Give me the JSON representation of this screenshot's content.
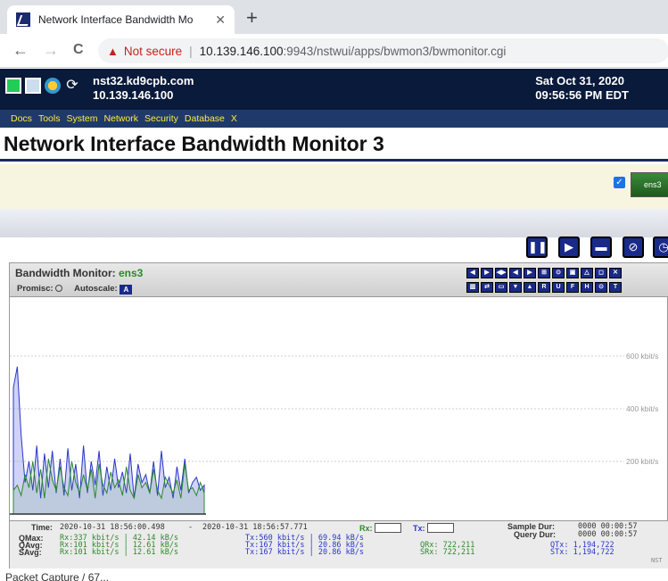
{
  "browser": {
    "tab_title": "Network Interface Bandwidth Mo",
    "tab_close": "✕",
    "new_tab": "+",
    "back": "←",
    "forward": "→",
    "reload": "C",
    "warning_icon": "▲",
    "not_secure": "Not secure",
    "url_host": "10.139.146.100",
    "url_rest": ":9943/nstwui/apps/bwmon3/bwmonitor.cgi"
  },
  "header": {
    "hostname": "nst32.kd9cpb.com",
    "ip": "10.139.146.100",
    "date": "Sat Oct 31, 2020",
    "time": "09:56:56 PM EDT"
  },
  "menu": [
    "Docs",
    "Tools",
    "System",
    "Network",
    "Security",
    "Database",
    "X"
  ],
  "page_title": "Network Interface Bandwidth Monitor 3",
  "interface_card_label": "ens3",
  "panel": {
    "title_prefix": "Bandwidth Monitor:",
    "interface": "ens3",
    "promisc_label": "Promisc:",
    "autoscale_label": "Autoscale:",
    "autoscale_btn": "A"
  },
  "toolbar_row1": [
    "◀",
    "▶",
    "◀▶",
    "◀",
    "▶",
    "⊞",
    "⊙",
    "▣",
    "△",
    "◻",
    "✕"
  ],
  "toolbar_row2": [
    "▥",
    "⇄",
    "▭",
    "▼",
    "▲",
    "R",
    "U",
    "F",
    "H",
    "⊙",
    "T"
  ],
  "chart_data": {
    "type": "area",
    "y_tick_labels": [
      "600 kbit/s",
      "400 kbit/s",
      "200 kbit/s"
    ],
    "y_ticks": [
      600,
      400,
      200
    ],
    "ylim": [
      0,
      800
    ],
    "grid": true,
    "series": [
      {
        "name": "Tx",
        "color": "#2a35c8",
        "values": [
          480,
          560,
          300,
          120,
          200,
          90,
          260,
          60,
          230,
          100,
          240,
          80,
          210,
          70,
          250,
          90,
          190,
          60,
          260,
          80,
          200,
          110,
          240,
          70,
          180,
          90,
          210,
          100,
          160,
          80,
          230,
          60,
          190,
          120,
          150,
          80,
          200,
          70,
          240,
          100,
          140,
          60,
          180,
          90,
          210,
          80,
          120,
          140,
          90,
          110
        ]
      },
      {
        "name": "Rx",
        "color": "#2a8a2a",
        "values": [
          90,
          110,
          70,
          150,
          100,
          200,
          80,
          170,
          60,
          210,
          130,
          90,
          180,
          100,
          70,
          200,
          120,
          80,
          150,
          90,
          170,
          60,
          190,
          110,
          80,
          160,
          100,
          130,
          70,
          180,
          90,
          60,
          150,
          100,
          120,
          80,
          170,
          90,
          60,
          140,
          110,
          80,
          130,
          60,
          190,
          90,
          100,
          70,
          120,
          80
        ]
      }
    ]
  },
  "stats": {
    "time_label": "Time:",
    "time_start": "2020-10-31 18:56:00.498",
    "time_sep": "-",
    "time_end": "2020-10-31 18:56:57.771",
    "rx_label": "Rx:",
    "tx_label": "Tx:",
    "sample_dur_label": "Sample Dur:",
    "sample_dur": "0000 00:00:57",
    "query_dur_label": "Query Dur:",
    "query_dur": "0000 00:00:57",
    "qmax_label": "QMax:",
    "qavg_label": "QAvg:",
    "savg_label": "SAvg:",
    "qmax_rx": "Rx:337 kbit/s | 42.14 kB/s",
    "qavg_rx": "Rx:101 kbit/s | 12.61 kB/s",
    "savg_rx": "Rx:101 kbit/s | 12.61 kB/s",
    "qmax_tx": "Tx:560 kbit/s | 69.94 kB/s",
    "qavg_tx": "Tx:167 kbit/s | 20.86 kB/s",
    "savg_tx": "Tx:167 kbit/s | 20.86 kB/s",
    "qrx": "QRx: 722,211",
    "srx": "SRx: 722,211",
    "qtx": "QTx: 1,194,722",
    "stx": "STx: 1,194,722",
    "corner": "NST"
  },
  "bottom_text": "Packet Capture / 67..."
}
